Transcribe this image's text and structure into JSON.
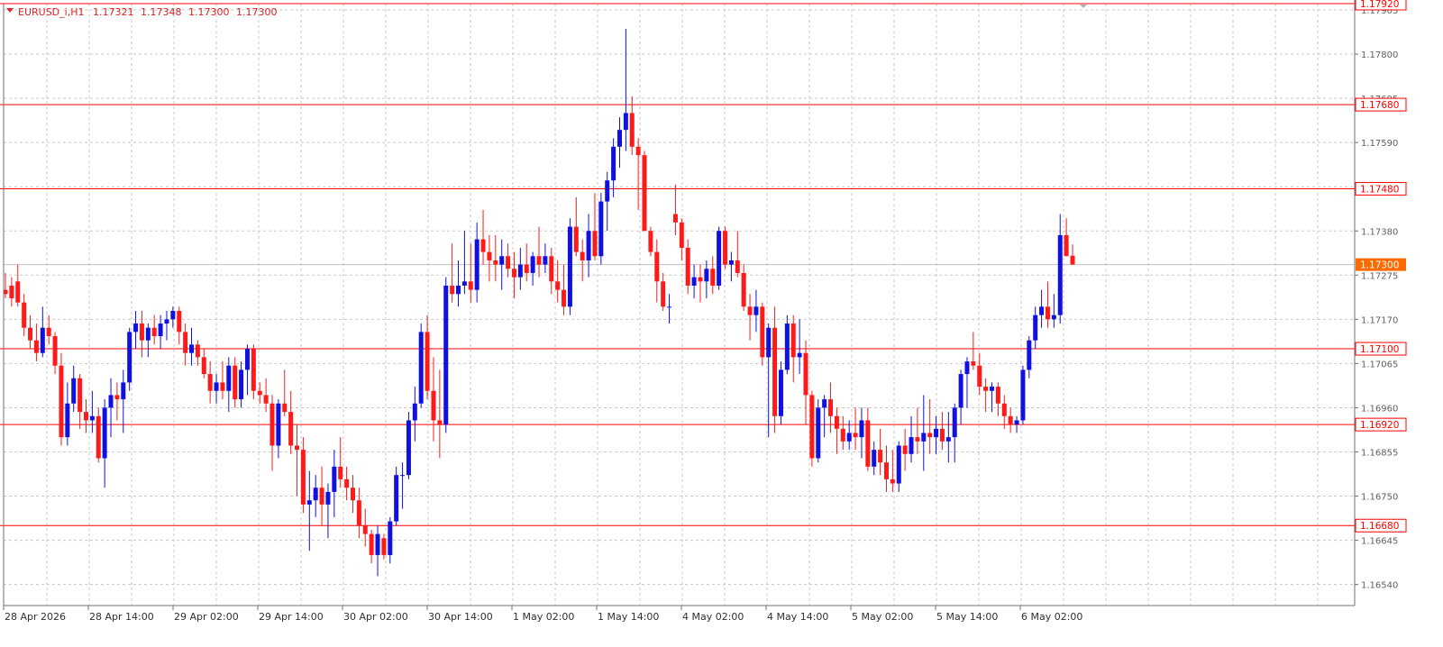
{
  "header": {
    "symbol": "EURUSD_i,H1",
    "open": "1.17321",
    "high": "1.17348",
    "low": "1.17300",
    "close": "1.17300"
  },
  "colors": {
    "bull": "#1010e0",
    "bear": "#ff1a1a",
    "level_line": "#ff0000",
    "current_price_bg": "#ff6a00",
    "grid": "#c8c8c8",
    "axis_text": "#606060",
    "date_text": "#303030"
  },
  "price_axis": {
    "labels": [
      "1.17905",
      "1.17800",
      "1.17695",
      "1.17590",
      "1.17485",
      "1.17380",
      "1.17275",
      "1.17170",
      "1.17065",
      "1.16960",
      "1.16855",
      "1.16750",
      "1.16645",
      "1.16540"
    ]
  },
  "time_axis": {
    "labels": [
      "28 Apr 2026",
      "28 Apr 14:00",
      "29 Apr 02:00",
      "29 Apr 14:00",
      "30 Apr 02:00",
      "30 Apr 14:00",
      "1 May 02:00",
      "1 May 14:00",
      "4 May 02:00",
      "4 May 14:00",
      "5 May 02:00",
      "5 May 14:00",
      "6 May 02:00"
    ]
  },
  "levels": [
    {
      "label": "1.17920",
      "price": 1.1792
    },
    {
      "label": "1.17680",
      "price": 1.1768
    },
    {
      "label": "1.17480",
      "price": 1.1748
    },
    {
      "label": "1.17100",
      "price": 1.171
    },
    {
      "label": "1.16920",
      "price": 1.1692
    },
    {
      "label": "1.16680",
      "price": 1.1668
    }
  ],
  "current_price": {
    "label": "1.17300",
    "price": 1.173
  },
  "chart_data": {
    "type": "candlestick",
    "symbol": "EURUSD_i",
    "timeframe": "H1",
    "ylim": [
      1.1649,
      1.1792
    ],
    "ohlc": [
      [
        1.1724,
        1.1728,
        1.1722,
        1.1723
      ],
      [
        1.1725,
        1.1727,
        1.172,
        1.1722
      ],
      [
        1.1726,
        1.173,
        1.172,
        1.1721
      ],
      [
        1.1721,
        1.1723,
        1.1713,
        1.1715
      ],
      [
        1.1715,
        1.1718,
        1.171,
        1.1712
      ],
      [
        1.1712,
        1.1716,
        1.1707,
        1.1709
      ],
      [
        1.1709,
        1.172,
        1.1708,
        1.1715
      ],
      [
        1.1715,
        1.1718,
        1.1711,
        1.1713
      ],
      [
        1.1713,
        1.1714,
        1.1704,
        1.1706
      ],
      [
        1.1706,
        1.1709,
        1.1687,
        1.1689
      ],
      [
        1.1689,
        1.1702,
        1.1687,
        1.1697
      ],
      [
        1.1697,
        1.1706,
        1.1695,
        1.1703
      ],
      [
        1.1703,
        1.1704,
        1.1691,
        1.1695
      ],
      [
        1.1695,
        1.1698,
        1.169,
        1.1693
      ],
      [
        1.1693,
        1.17,
        1.169,
        1.1694
      ],
      [
        1.1694,
        1.1696,
        1.1683,
        1.1684
      ],
      [
        1.1684,
        1.1698,
        1.1677,
        1.1696
      ],
      [
        1.1696,
        1.1703,
        1.1689,
        1.1699
      ],
      [
        1.1699,
        1.1702,
        1.1693,
        1.1698
      ],
      [
        1.1698,
        1.1705,
        1.169,
        1.1702
      ],
      [
        1.1702,
        1.1715,
        1.17,
        1.1714
      ],
      [
        1.1714,
        1.1719,
        1.171,
        1.1716
      ],
      [
        1.1716,
        1.1719,
        1.1708,
        1.1712
      ],
      [
        1.1712,
        1.1716,
        1.1708,
        1.1715
      ],
      [
        1.1715,
        1.1718,
        1.1711,
        1.1713
      ],
      [
        1.1713,
        1.1718,
        1.171,
        1.1716
      ],
      [
        1.1716,
        1.1719,
        1.1712,
        1.1717
      ],
      [
        1.1717,
        1.172,
        1.1715,
        1.1719
      ],
      [
        1.1719,
        1.172,
        1.1711,
        1.1714
      ],
      [
        1.1714,
        1.1716,
        1.1706,
        1.1709
      ],
      [
        1.1709,
        1.1715,
        1.1706,
        1.1711
      ],
      [
        1.1711,
        1.1712,
        1.1706,
        1.1708
      ],
      [
        1.1708,
        1.171,
        1.1703,
        1.1704
      ],
      [
        1.1704,
        1.1707,
        1.1697,
        1.17
      ],
      [
        1.17,
        1.1704,
        1.1697,
        1.1702
      ],
      [
        1.1702,
        1.1707,
        1.1698,
        1.17
      ],
      [
        1.17,
        1.1708,
        1.1695,
        1.1706
      ],
      [
        1.1706,
        1.1708,
        1.1696,
        1.1698
      ],
      [
        1.1698,
        1.1707,
        1.1696,
        1.1705
      ],
      [
        1.1705,
        1.1711,
        1.1699,
        1.171
      ],
      [
        1.171,
        1.1711,
        1.1698,
        1.17
      ],
      [
        1.17,
        1.1702,
        1.1697,
        1.1699
      ],
      [
        1.1699,
        1.1703,
        1.1695,
        1.1697
      ],
      [
        1.1697,
        1.1699,
        1.1681,
        1.1687
      ],
      [
        1.1687,
        1.1698,
        1.1684,
        1.1697
      ],
      [
        1.1697,
        1.1705,
        1.1694,
        1.1695
      ],
      [
        1.1695,
        1.17,
        1.1685,
        1.1687
      ],
      [
        1.1687,
        1.1692,
        1.1675,
        1.1686
      ],
      [
        1.1686,
        1.1689,
        1.1671,
        1.1673
      ],
      [
        1.1673,
        1.1681,
        1.1662,
        1.1674
      ],
      [
        1.1674,
        1.168,
        1.167,
        1.1677
      ],
      [
        1.1677,
        1.1682,
        1.1668,
        1.1673
      ],
      [
        1.1673,
        1.1678,
        1.1665,
        1.1676
      ],
      [
        1.1676,
        1.1686,
        1.167,
        1.1682
      ],
      [
        1.1682,
        1.1689,
        1.1677,
        1.1679
      ],
      [
        1.1679,
        1.1682,
        1.1674,
        1.1677
      ],
      [
        1.1677,
        1.168,
        1.1671,
        1.1674
      ],
      [
        1.1674,
        1.1677,
        1.1665,
        1.1668
      ],
      [
        1.1668,
        1.1672,
        1.1663,
        1.1666
      ],
      [
        1.1666,
        1.1667,
        1.1659,
        1.1661
      ],
      [
        1.1661,
        1.1668,
        1.1656,
        1.1666
      ],
      [
        1.1665,
        1.1666,
        1.166,
        1.1661
      ],
      [
        1.1661,
        1.167,
        1.1659,
        1.1669
      ],
      [
        1.1669,
        1.1682,
        1.1668,
        1.168
      ],
      [
        1.168,
        1.1683,
        1.1672,
        1.168
      ],
      [
        1.168,
        1.1695,
        1.1679,
        1.1693
      ],
      [
        1.1693,
        1.1701,
        1.1688,
        1.1697
      ],
      [
        1.1697,
        1.1716,
        1.1696,
        1.1714
      ],
      [
        1.1714,
        1.1718,
        1.1698,
        1.17
      ],
      [
        1.17,
        1.1708,
        1.1688,
        1.1693
      ],
      [
        1.1693,
        1.1705,
        1.1684,
        1.1692
      ],
      [
        1.1692,
        1.1727,
        1.169,
        1.1725
      ],
      [
        1.1725,
        1.1735,
        1.1721,
        1.1723
      ],
      [
        1.1723,
        1.1731,
        1.172,
        1.1725
      ],
      [
        1.1725,
        1.1738,
        1.1723,
        1.1726
      ],
      [
        1.1726,
        1.1735,
        1.1721,
        1.1724
      ],
      [
        1.1724,
        1.174,
        1.1721,
        1.1736
      ],
      [
        1.1736,
        1.1743,
        1.173,
        1.1733
      ],
      [
        1.1733,
        1.1737,
        1.1726,
        1.1731
      ],
      [
        1.1731,
        1.1737,
        1.1726,
        1.173
      ],
      [
        1.173,
        1.1736,
        1.1724,
        1.1732
      ],
      [
        1.1732,
        1.1735,
        1.1727,
        1.1729
      ],
      [
        1.1729,
        1.1733,
        1.1722,
        1.1727
      ],
      [
        1.1727,
        1.1734,
        1.1724,
        1.173
      ],
      [
        1.173,
        1.1735,
        1.1726,
        1.1728
      ],
      [
        1.1728,
        1.1733,
        1.1725,
        1.1732
      ],
      [
        1.1732,
        1.1739,
        1.1727,
        1.173
      ],
      [
        1.173,
        1.1735,
        1.1728,
        1.1732
      ],
      [
        1.1732,
        1.1734,
        1.1723,
        1.1726
      ],
      [
        1.1726,
        1.1731,
        1.1721,
        1.1724
      ],
      [
        1.1724,
        1.173,
        1.1718,
        1.172
      ],
      [
        1.172,
        1.1741,
        1.1718,
        1.1739
      ],
      [
        1.1739,
        1.1746,
        1.1732,
        1.1733
      ],
      [
        1.1733,
        1.1736,
        1.1726,
        1.1731
      ],
      [
        1.1731,
        1.1742,
        1.1727,
        1.1738
      ],
      [
        1.1738,
        1.1747,
        1.1731,
        1.1732
      ],
      [
        1.1732,
        1.1747,
        1.173,
        1.1745
      ],
      [
        1.1745,
        1.1752,
        1.1738,
        1.175
      ],
      [
        1.175,
        1.176,
        1.1746,
        1.1758
      ],
      [
        1.1758,
        1.1765,
        1.1753,
        1.1762
      ],
      [
        1.1762,
        1.1786,
        1.1757,
        1.1766
      ],
      [
        1.1766,
        1.177,
        1.1756,
        1.1758
      ],
      [
        1.1758,
        1.176,
        1.1743,
        1.1756
      ],
      [
        1.1756,
        1.1757,
        1.1738,
        1.1738
      ],
      [
        1.1738,
        1.1739,
        1.1732,
        1.1733
      ],
      [
        1.1733,
        1.1736,
        1.1721,
        1.1726
      ],
      [
        1.1726,
        1.1728,
        1.1719,
        1.172
      ],
      [
        1.172,
        1.1723,
        1.1716,
        1.172
      ],
      [
        1.1742,
        1.1749,
        1.1737,
        1.174
      ],
      [
        1.174,
        1.1741,
        1.1731,
        1.1734
      ],
      [
        1.1734,
        1.1736,
        1.1723,
        1.1725
      ],
      [
        1.1725,
        1.173,
        1.1722,
        1.1727
      ],
      [
        1.1727,
        1.173,
        1.1721,
        1.1726
      ],
      [
        1.1726,
        1.1731,
        1.1722,
        1.1729
      ],
      [
        1.1729,
        1.1732,
        1.1723,
        1.1725
      ],
      [
        1.1725,
        1.1739,
        1.1724,
        1.1738
      ],
      [
        1.1738,
        1.1739,
        1.1729,
        1.173
      ],
      [
        1.173,
        1.1733,
        1.1726,
        1.1731
      ],
      [
        1.1731,
        1.1738,
        1.1727,
        1.1728
      ],
      [
        1.1728,
        1.173,
        1.1719,
        1.172
      ],
      [
        1.172,
        1.1723,
        1.1712,
        1.1718
      ],
      [
        1.1718,
        1.1724,
        1.1714,
        1.172
      ],
      [
        1.172,
        1.1721,
        1.1706,
        1.1708
      ],
      [
        1.1708,
        1.1716,
        1.1689,
        1.1715
      ],
      [
        1.1715,
        1.172,
        1.169,
        1.1694
      ],
      [
        1.1694,
        1.1707,
        1.1692,
        1.1705
      ],
      [
        1.1705,
        1.1718,
        1.1704,
        1.1716
      ],
      [
        1.1716,
        1.1718,
        1.1702,
        1.1708
      ],
      [
        1.1708,
        1.1717,
        1.1704,
        1.1709
      ],
      [
        1.1709,
        1.1712,
        1.1692,
        1.1699
      ],
      [
        1.1699,
        1.17,
        1.1682,
        1.1684
      ],
      [
        1.1684,
        1.1698,
        1.1683,
        1.1696
      ],
      [
        1.1696,
        1.1699,
        1.1689,
        1.1698
      ],
      [
        1.1698,
        1.1702,
        1.169,
        1.1694
      ],
      [
        1.1694,
        1.1696,
        1.1685,
        1.1691
      ],
      [
        1.1691,
        1.1694,
        1.1686,
        1.1688
      ],
      [
        1.1688,
        1.1693,
        1.1686,
        1.169
      ],
      [
        1.169,
        1.1696,
        1.1686,
        1.1689
      ],
      [
        1.1689,
        1.1696,
        1.1684,
        1.1693
      ],
      [
        1.1693,
        1.1696,
        1.1681,
        1.1682
      ],
      [
        1.1682,
        1.1688,
        1.168,
        1.1686
      ],
      [
        1.1686,
        1.1691,
        1.168,
        1.1683
      ],
      [
        1.1683,
        1.1687,
        1.1676,
        1.1679
      ],
      [
        1.1679,
        1.1686,
        1.1676,
        1.1678
      ],
      [
        1.1678,
        1.1688,
        1.1676,
        1.1687
      ],
      [
        1.1687,
        1.1691,
        1.1681,
        1.1685
      ],
      [
        1.1685,
        1.1694,
        1.1683,
        1.1689
      ],
      [
        1.1689,
        1.1696,
        1.1685,
        1.1688
      ],
      [
        1.1688,
        1.1699,
        1.1681,
        1.169
      ],
      [
        1.169,
        1.1698,
        1.1685,
        1.1689
      ],
      [
        1.1689,
        1.1694,
        1.1685,
        1.1691
      ],
      [
        1.1691,
        1.1695,
        1.1686,
        1.1688
      ],
      [
        1.1688,
        1.1695,
        1.1683,
        1.1689
      ],
      [
        1.1689,
        1.1697,
        1.1683,
        1.1696
      ],
      [
        1.1696,
        1.1705,
        1.1692,
        1.1704
      ],
      [
        1.1704,
        1.1708,
        1.1696,
        1.1707
      ],
      [
        1.1707,
        1.1714,
        1.1705,
        1.1706
      ],
      [
        1.1706,
        1.1709,
        1.1699,
        1.1701
      ],
      [
        1.1701,
        1.1703,
        1.1695,
        1.17
      ],
      [
        1.17,
        1.1702,
        1.1695,
        1.1701
      ],
      [
        1.1701,
        1.1702,
        1.1694,
        1.1697
      ],
      [
        1.1697,
        1.1699,
        1.1691,
        1.1694
      ],
      [
        1.1694,
        1.1696,
        1.169,
        1.1692
      ],
      [
        1.1692,
        1.1694,
        1.169,
        1.1693
      ],
      [
        1.1693,
        1.1706,
        1.1692,
        1.1705
      ],
      [
        1.1705,
        1.1713,
        1.1703,
        1.1712
      ],
      [
        1.1712,
        1.172,
        1.171,
        1.1718
      ],
      [
        1.1718,
        1.1724,
        1.1715,
        1.172
      ],
      [
        1.172,
        1.1726,
        1.1715,
        1.1717
      ],
      [
        1.1717,
        1.1723,
        1.1715,
        1.1718
      ],
      [
        1.1718,
        1.1742,
        1.1716,
        1.1737
      ],
      [
        1.1737,
        1.1741,
        1.1732,
        1.1732
      ],
      [
        1.17321,
        1.17348,
        1.173,
        1.173
      ]
    ]
  }
}
